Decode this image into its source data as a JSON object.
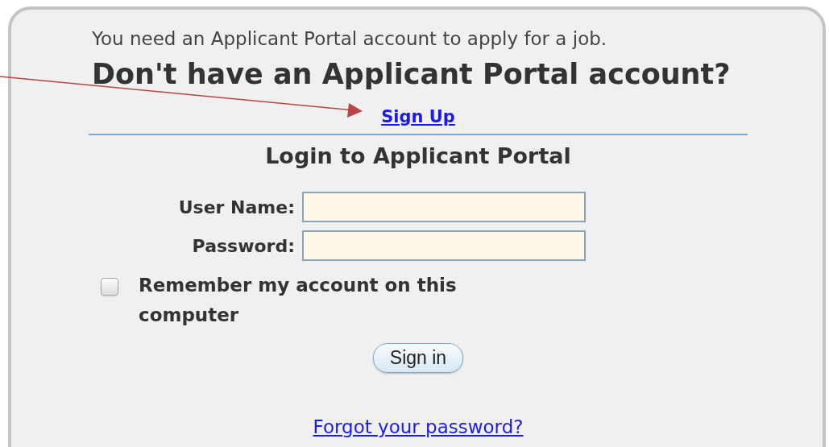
{
  "intro": "You need an Applicant Portal account to apply for a job.",
  "heading": "Don't have an Applicant Portal account?",
  "signup_link": "Sign Up",
  "login_title": "Login to Applicant Portal",
  "fields": [
    {
      "label": "User Name:"
    },
    {
      "label": "Password:"
    }
  ],
  "remember": {
    "label": "Remember my account on this computer",
    "checked": false
  },
  "sign_in_button": "Sign in",
  "forgot_link": "Forgot your password?"
}
